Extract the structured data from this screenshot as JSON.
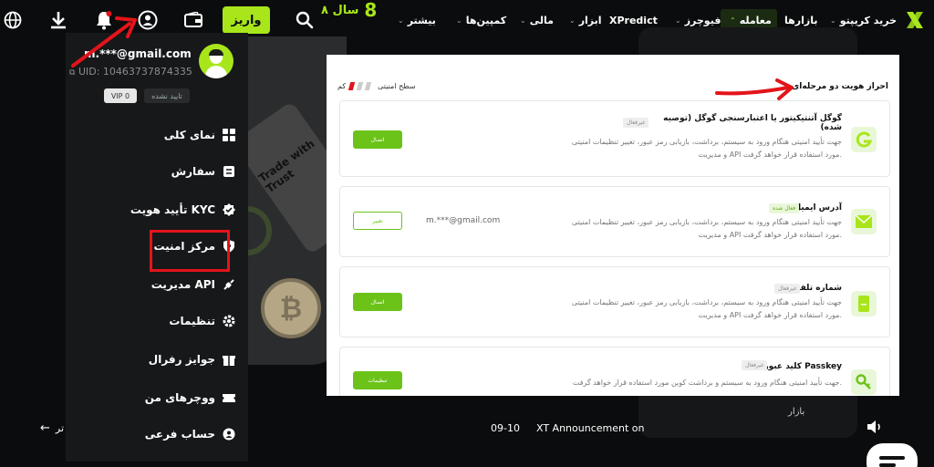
{
  "colors": {
    "accent": "#a8e61b",
    "panel_accent": "#6bc31a",
    "highlight_red": "#e3141a",
    "bg": "#0b0c0d",
    "menu_bg": "#17181a"
  },
  "topbar": {
    "logo_icon": "xt-logo-icon",
    "nav": [
      {
        "label": "خرید کریپتو",
        "chevron": "⌄"
      },
      {
        "label": "بازارها"
      },
      {
        "label": "معامله",
        "chevron": "⌃"
      },
      {
        "label": "فیوچرز",
        "chevron": "⌄"
      },
      {
        "label": "XPredict"
      },
      {
        "label": "ابزار",
        "chevron": "⌄"
      },
      {
        "label": "مالی",
        "chevron": "⌄"
      },
      {
        "label": "کمپین‌ها",
        "chevron": "⌄"
      },
      {
        "label": "بیشتر",
        "chevron": "⌄"
      }
    ],
    "anniversary": {
      "label": "۸ سال",
      "badge": "8"
    },
    "deposit_label": "واریز",
    "icons": [
      "search-icon",
      "wallet-icon",
      "user-icon",
      "bell-icon",
      "download-icon",
      "globe-icon"
    ]
  },
  "promo": {
    "banner_text": "Trade with Trust",
    "coin_symbol": "₿"
  },
  "dropdown": {
    "email": "m.***@gmail.com",
    "uid": "UID: 10463737874335",
    "kyc_status": "تایید نشده",
    "vip": "VIP 0",
    "items": [
      {
        "label": "نمای کلی",
        "icon": "grid-icon"
      },
      {
        "label": "سفارش",
        "icon": "list-icon"
      },
      {
        "label": "تأیید هویت KYC",
        "icon": "verified-icon"
      },
      {
        "label": "مرکز امنیت",
        "icon": "shield-icon"
      },
      {
        "label": "مدیریت API",
        "icon": "api-icon"
      },
      {
        "label": "تنظیمات",
        "icon": "gear-icon"
      },
      {
        "label": "جوایز رفرال",
        "icon": "gift-icon"
      },
      {
        "label": "ووچرهای من",
        "icon": "ticket-icon"
      },
      {
        "label": "حساب فرعی",
        "icon": "sub-account-icon"
      }
    ]
  },
  "security_panel": {
    "title": "احراز هویت دو مرحله‌ای",
    "level_label": "سطح امنیتی",
    "level_value": "کم",
    "cards": [
      {
        "title": "گوگل آتنتیکیتور یا اعتبارسنجی گوگل (توصیه شده)",
        "status": "غیرفعال",
        "desc": "جهت تأیید امنیتی هنگام ورود به سیستم، برداشت، بازیابی رمز عبور، تغییر تنظیمات امنیتی و مدیریت API مورد استفاده قرار خواهد گرفت.",
        "button": "اتصال",
        "icon": "google-auth-icon"
      },
      {
        "title": "آدرس ایمیل",
        "status": "فعال شده",
        "desc": "جهت تأیید امنیتی هنگام ورود به سیستم، برداشت، بازیابی رمز عبور، تغییر تنظیمات امنیتی و مدیریت API مورد استفاده قرار خواهد گرفت.",
        "value": "m.***@gmail.com",
        "button": "تغییر",
        "icon": "email-icon"
      },
      {
        "title": "شماره تلفن",
        "status": "غیرفعال",
        "desc": "جهت تأیید امنیتی هنگام ورود به سیستم، برداشت، بازیابی رمز عبور، تغییر تنظیمات امنیتی و مدیریت API مورد استفاده قرار خواهد گرفت.",
        "button": "اتصال",
        "icon": "phone-icon"
      },
      {
        "title": "کلید عبور یا Passkey",
        "status": "غیرفعال",
        "desc": "جهت تأیید امنیتی هنگام ورود به سیستم و برداشت کوین مورد استفاده قرار خواهد گرفت.",
        "button": "تنظیمات",
        "icon": "passkey-icon"
      }
    ]
  },
  "ticker": {
    "text": "XT Announcement on",
    "date": "09-10",
    "back_label": "تر",
    "market_label": "بازار"
  }
}
